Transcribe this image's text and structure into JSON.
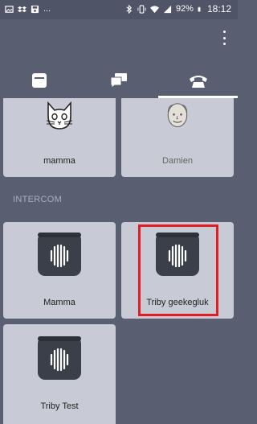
{
  "status_bar": {
    "left_icons": [
      "image-icon",
      "dropbox-icon",
      "save-icon",
      "more-notifications-icon"
    ],
    "ellipsis": "...",
    "right_icons": [
      "bluetooth-icon",
      "vibrate-icon",
      "wifi-icon",
      "signal-icon"
    ],
    "battery": "92%",
    "time": "18:12"
  },
  "tabs": [
    {
      "name": "devices",
      "icon": "device-icon",
      "active": false
    },
    {
      "name": "messages",
      "icon": "chat-bubbles-icon",
      "active": false
    },
    {
      "name": "calls",
      "icon": "phone-icon",
      "active": true
    }
  ],
  "contacts": [
    {
      "label": "mamma",
      "icon": "cat-avatar-icon",
      "dim": false
    },
    {
      "label": "Damien",
      "icon": "man-avatar-icon",
      "dim": true
    }
  ],
  "intercom": {
    "header": "INTERCOM",
    "devices": [
      {
        "label": "Mamma",
        "icon": "triby-speaker-icon",
        "highlighted": false
      },
      {
        "label": "Triby geekegluk",
        "icon": "triby-speaker-icon",
        "highlighted": true
      },
      {
        "label": "Triby Test",
        "icon": "triby-speaker-icon",
        "highlighted": false
      }
    ]
  },
  "colors": {
    "background": "#595f71",
    "card": "#c8cbd6",
    "highlight": "#e51b24",
    "triby_icon": "#3a3f4a"
  }
}
